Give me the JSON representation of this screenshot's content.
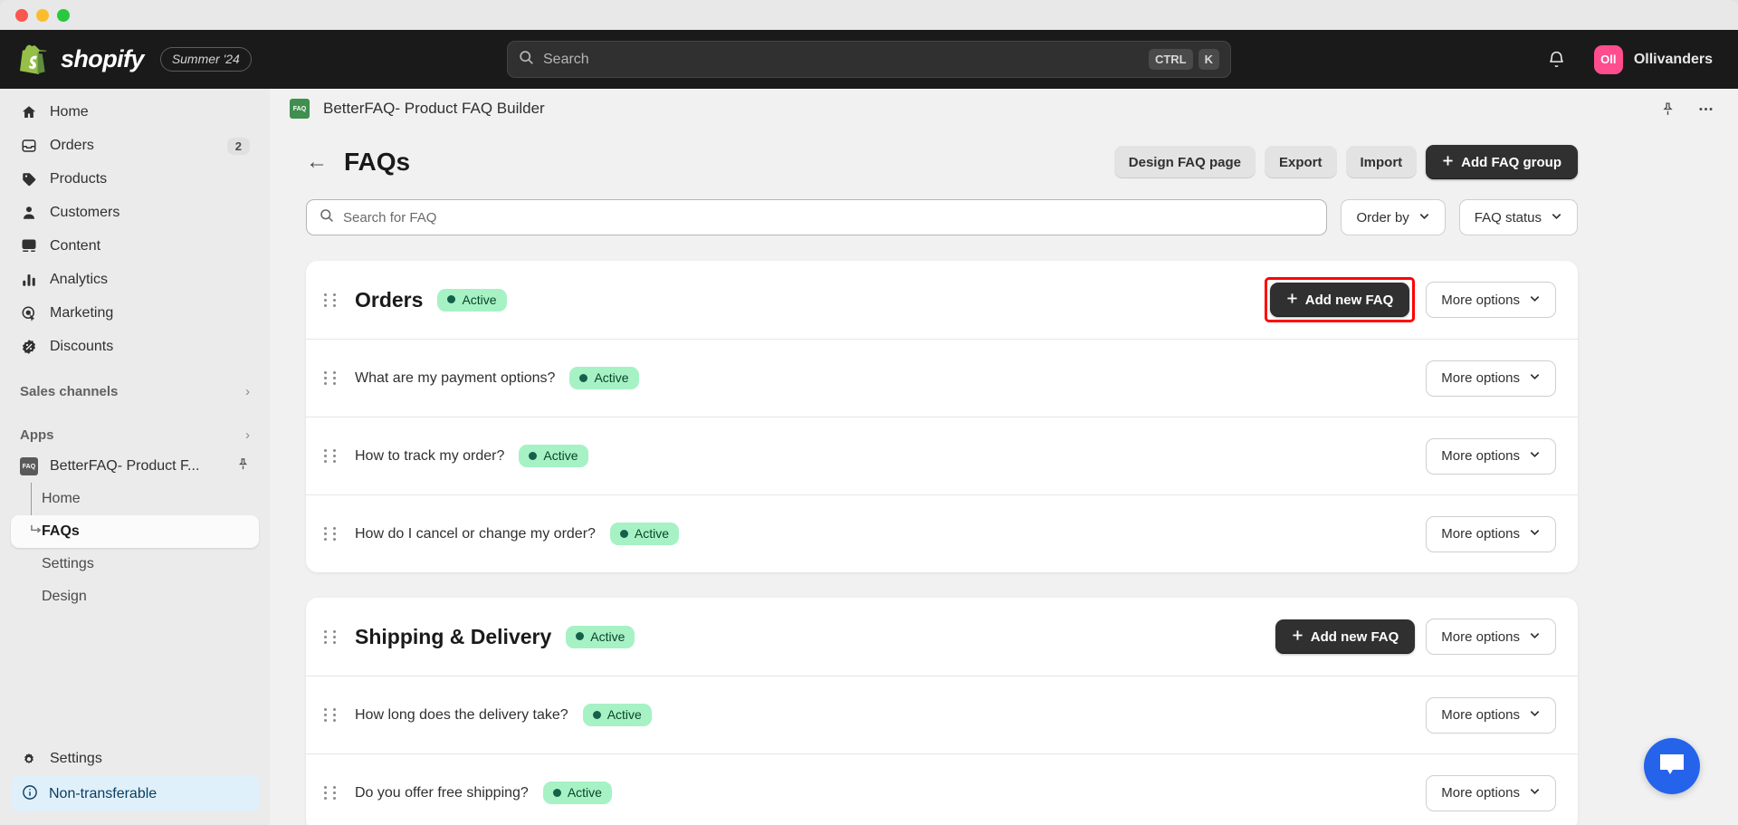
{
  "brand": {
    "name": "shopify",
    "season_badge": "Summer '24",
    "logo_icon": "shopify-bag-icon"
  },
  "topnav": {
    "search": {
      "placeholder": "Search",
      "value": "",
      "icon": "search-icon"
    },
    "shortcut_keys": [
      "CTRL",
      "K"
    ],
    "notifications_icon": "bell-icon",
    "user": {
      "initials": "Oll",
      "name": "Ollivanders",
      "avatar_color": "#ff4d8d"
    }
  },
  "sidebar": {
    "items": [
      {
        "label": "Home",
        "icon": "home-icon",
        "badge": ""
      },
      {
        "label": "Orders",
        "icon": "orders-inbox-icon",
        "badge": "2"
      },
      {
        "label": "Products",
        "icon": "tag-icon",
        "badge": ""
      },
      {
        "label": "Customers",
        "icon": "person-icon",
        "badge": ""
      },
      {
        "label": "Content",
        "icon": "content-image-icon",
        "badge": ""
      },
      {
        "label": "Analytics",
        "icon": "bar-chart-icon",
        "badge": ""
      },
      {
        "label": "Marketing",
        "icon": "target-cursor-icon",
        "badge": ""
      },
      {
        "label": "Discounts",
        "icon": "discount-badge-icon",
        "badge": ""
      }
    ],
    "sections": [
      {
        "label": "Sales channels",
        "chevron": "chevron-right-icon"
      },
      {
        "label": "Apps",
        "chevron": "chevron-right-icon"
      }
    ],
    "app": {
      "label": "BetterFAQ- Product F...",
      "icon": "faq-app-icon",
      "pin_icon": "pin-icon",
      "children": [
        {
          "label": "Home",
          "active": false
        },
        {
          "label": "FAQs",
          "active": true
        },
        {
          "label": "Settings",
          "active": false
        },
        {
          "label": "Design",
          "active": false
        }
      ]
    },
    "settings": {
      "label": "Settings",
      "icon": "gear-icon"
    },
    "non_transferable": {
      "label": "Non-transferable",
      "icon": "info-circle-icon"
    }
  },
  "app_header": {
    "title": "BetterFAQ- Product FAQ Builder",
    "icon": "faq-app-icon",
    "pin_icon": "pin-icon",
    "more_icon": "ellipsis-horizontal-icon"
  },
  "page": {
    "back_icon": "arrow-left-icon",
    "title": "FAQs",
    "buttons": [
      {
        "label": "Design FAQ page",
        "style": "subtle"
      },
      {
        "label": "Export",
        "style": "subtle"
      },
      {
        "label": "Import",
        "style": "subtle"
      }
    ],
    "primary_button": {
      "label": "Add FAQ group",
      "icon": "plus-icon"
    }
  },
  "filters": {
    "search": {
      "placeholder": "Search for FAQ",
      "value": "",
      "icon": "search-icon"
    },
    "order_by": {
      "label": "Order by",
      "chevron": "chevron-down-icon"
    },
    "faq_status": {
      "label": "FAQ status",
      "chevron": "chevron-down-icon"
    }
  },
  "labels": {
    "add_new_faq": "Add new FAQ",
    "more_options": "More options",
    "status_active": "Active",
    "grip_icon": "drag-handle-icon",
    "plus_icon": "plus-icon",
    "chevron_down_icon": "chevron-down-icon"
  },
  "groups": [
    {
      "title": "Orders",
      "status": "Active",
      "add_button_highlighted": true,
      "faqs": [
        {
          "question": "What are my payment options?",
          "status": "Active"
        },
        {
          "question": "How to track my order?",
          "status": "Active"
        },
        {
          "question": "How do I cancel or change my order?",
          "status": "Active"
        }
      ]
    },
    {
      "title": "Shipping & Delivery",
      "status": "Active",
      "add_button_highlighted": false,
      "faqs": [
        {
          "question": "How long does the delivery take?",
          "status": "Active"
        },
        {
          "question": "Do you offer free shipping?",
          "status": "Active"
        }
      ]
    }
  ],
  "chat_widget": {
    "icon": "chat-bubble-icon",
    "color": "#2563eb"
  },
  "colors": {
    "accent_dark": "#303030",
    "highlight_ring": "#ff0000",
    "active_badge_bg": "#a6f2c5",
    "active_badge_text": "#0b4228",
    "chat_blue": "#2563eb",
    "avatar_pink": "#ff4d8d"
  },
  "window_controls": [
    "close",
    "minimize",
    "maximize"
  ]
}
